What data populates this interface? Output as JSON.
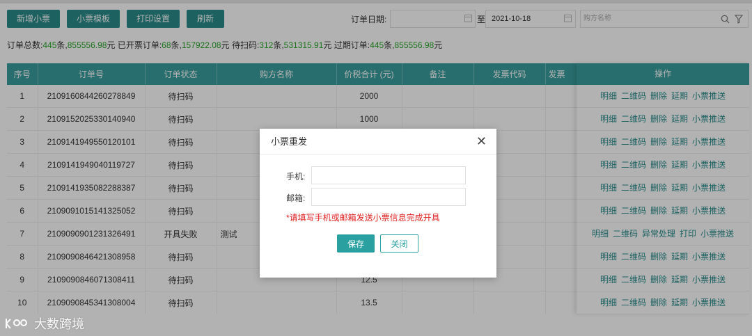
{
  "toolbar": {
    "add_receipt": "新增小票",
    "receipt_template": "小票模板",
    "print_settings": "打印设置",
    "refresh": "刷新"
  },
  "filters": {
    "order_date_label": "订单日期:",
    "start_date": "",
    "to_label": "至",
    "end_date": "2021-10-18",
    "buyer_placeholder": "购方名称"
  },
  "summary": {
    "total_label": "订单总数:",
    "total_count": "445",
    "total_amount": "855556.98",
    "invoiced_label": "已开票订单:",
    "invoiced_count": "68",
    "invoiced_amount": "157922.08",
    "pending_label": "待扫码:",
    "pending_count": "312",
    "pending_amount": "531315.91",
    "expired_label": "过期订单:",
    "expired_count": "445",
    "expired_amount": "855556.98",
    "unit_count": "条,",
    "unit_amount": "元"
  },
  "table": {
    "headers": [
      "序号",
      "订单号",
      "订单状态",
      "购方名称",
      "价税合计 (元)",
      "备注",
      "发票代码",
      "发票"
    ],
    "operation_header": "操作",
    "rows": [
      {
        "no": "1",
        "order": "2109160844260278849",
        "status": "待扫码",
        "buyer": "",
        "amount": "2000"
      },
      {
        "no": "2",
        "order": "2109152025330140940",
        "status": "待扫码",
        "buyer": "",
        "amount": "1000"
      },
      {
        "no": "3",
        "order": "2109141949550120101",
        "status": "待扫码",
        "buyer": "",
        "amount": ""
      },
      {
        "no": "4",
        "order": "2109141949040119727",
        "status": "待扫码",
        "buyer": "",
        "amount": ""
      },
      {
        "no": "5",
        "order": "2109141935082288387",
        "status": "待扫码",
        "buyer": "",
        "amount": ""
      },
      {
        "no": "6",
        "order": "2109091015141325052",
        "status": "待扫码",
        "buyer": "",
        "amount": ""
      },
      {
        "no": "7",
        "order": "2109090901231326491",
        "status": "开具失败",
        "buyer": "测试",
        "amount": ""
      },
      {
        "no": "8",
        "order": "2109090846421308958",
        "status": "待扫码",
        "buyer": "",
        "amount": ""
      },
      {
        "no": "9",
        "order": "2109090846071308411",
        "status": "待扫码",
        "buyer": "",
        "amount": "12.5"
      },
      {
        "no": "10",
        "order": "2109090845341308004",
        "status": "待扫码",
        "buyer": "",
        "amount": "13.5"
      }
    ],
    "ops_standard": [
      "明细",
      "二维码",
      "删除",
      "延期",
      "小票推送"
    ],
    "ops_failed": [
      "明细",
      "二维码",
      "异常处理",
      "打印",
      "小票推送"
    ]
  },
  "modal": {
    "title": "小票重发",
    "phone_label": "手机:",
    "email_label": "邮箱:",
    "warning": "*请填写手机或邮箱发送小票信息完成开具",
    "save": "保存",
    "close": "关闭"
  },
  "watermark": "大数跨境"
}
